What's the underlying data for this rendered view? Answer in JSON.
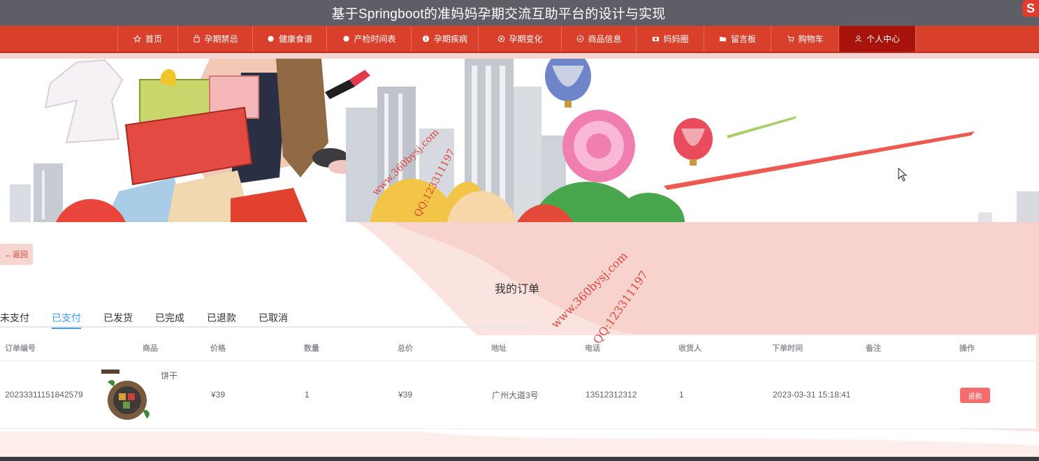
{
  "header": {
    "title": "基于Springboot的准妈妈孕期交流互助平台的设计与实现",
    "logo_text": "S"
  },
  "nav": {
    "items": [
      {
        "label": "首页",
        "icon": "star-icon"
      },
      {
        "label": "孕期禁忌",
        "icon": "bag-icon"
      },
      {
        "label": "健康食谱",
        "icon": "circle-icon"
      },
      {
        "label": "产检时间表",
        "icon": "circle-icon"
      },
      {
        "label": "孕期疾病",
        "icon": "info-icon"
      },
      {
        "label": "孕期变化",
        "icon": "gear-icon"
      },
      {
        "label": "商品信息",
        "icon": "circle-check-icon"
      },
      {
        "label": "妈妈圈",
        "icon": "camera-icon"
      },
      {
        "label": "留言板",
        "icon": "folder-icon"
      },
      {
        "label": "购物车",
        "icon": "cart-icon"
      },
      {
        "label": "个人中心",
        "icon": "user-icon"
      }
    ],
    "active_index": 10
  },
  "back_label": "←返回",
  "page_title": "我的订单",
  "tabs": [
    "未支付",
    "已支付",
    "已发货",
    "已完成",
    "已退款",
    "已取消"
  ],
  "active_tab": 1,
  "table": {
    "headers": [
      "订单编号",
      "商品",
      "价格",
      "数量",
      "总价",
      "地址",
      "电话",
      "收货人",
      "下单时间",
      "备注",
      "操作"
    ],
    "rows": [
      {
        "order_no": "20233311151842579",
        "product_name": "饼干",
        "price": "¥39",
        "quantity": "1",
        "total": "¥39",
        "address": "广州大道3号",
        "phone": "13512312312",
        "receiver": "1",
        "order_time": "2023-03-31 15:18:41",
        "remark": "",
        "action_label": "退款"
      }
    ]
  },
  "watermarks": {
    "site": "www.360bysj.com",
    "qq": "QQ:123311197"
  },
  "colors": {
    "nav_bg": "#d9402c",
    "nav_active": "#a8130b",
    "tab_active": "#409eff",
    "refund_button": "#f56c6c"
  }
}
